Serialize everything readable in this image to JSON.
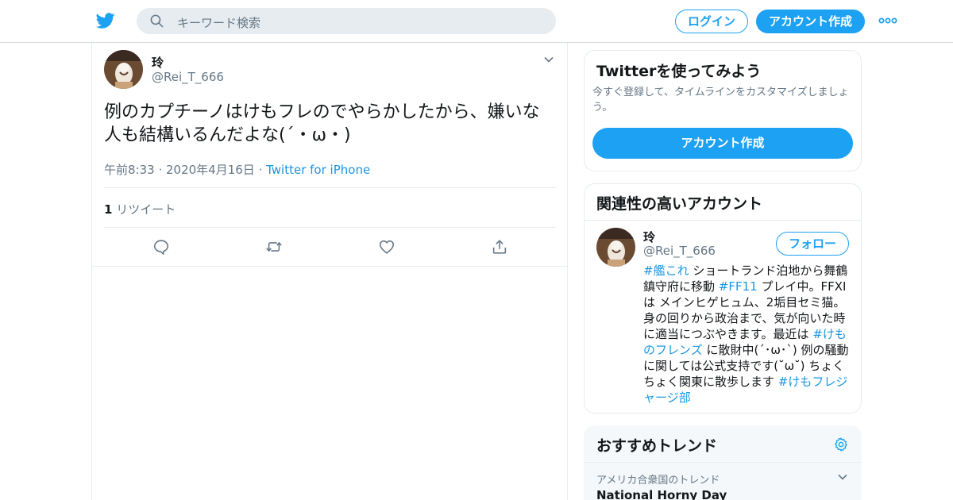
{
  "header": {
    "search_placeholder": "キーワード検索",
    "login_label": "ログイン",
    "signup_label": "アカウント作成",
    "icons": [
      "twitter-bird-icon",
      "search-icon",
      "more-dots-icon"
    ],
    "brand_color": "#1da1f2"
  },
  "tweet": {
    "author_name": "玲",
    "author_handle": "@Rei_T_666",
    "text": "例のカプチーノはけもフレのでやらかしたから、嫌いな人も結構いるんだよな(´・ω・)",
    "timestamp": "午前8:33 · 2020年4月16日",
    "separator": " · ",
    "source": "Twitter for iPhone",
    "retweet_count": "1",
    "retweet_label": "リツイート",
    "actions": [
      "reply-icon",
      "retweet-icon",
      "like-icon",
      "share-icon"
    ]
  },
  "sidebar": {
    "signup_card": {
      "title": "Twitterを使ってみよう",
      "subtitle": "今すぐ登録して、タイムラインをカスタマイズしましょう。",
      "button_label": "アカウント作成"
    },
    "related_card": {
      "title": "関連性の高いアカウント",
      "account": {
        "name": "玲",
        "handle": "@Rei_T_666",
        "follow_label": "フォロー",
        "bio_parts": [
          {
            "text": "#艦これ",
            "tag": true
          },
          {
            "text": " ショートランド泊地から舞鶴鎮守府に移動 ",
            "tag": false
          },
          {
            "text": "#FF11",
            "tag": true
          },
          {
            "text": " プレイ中。FFXIは メインヒゲヒュム、2垢目セミ猫。身の回りから政治まで、気が向いた時に適当につぶやきます。最近は ",
            "tag": false
          },
          {
            "text": "#けものフレンズ",
            "tag": true
          },
          {
            "text": " に散財中(´･ω･`) 例の騒動に関しては公式支持です(˘ω˘) ちょくちょく関東に散歩します ",
            "tag": false
          },
          {
            "text": "#けもフレジャージ部",
            "tag": true
          }
        ]
      }
    },
    "trends_card": {
      "title": "おすすめトレンド",
      "location_label": "アメリカ合衆国のトレンド",
      "trends": [
        "National Horny Day"
      ]
    }
  }
}
